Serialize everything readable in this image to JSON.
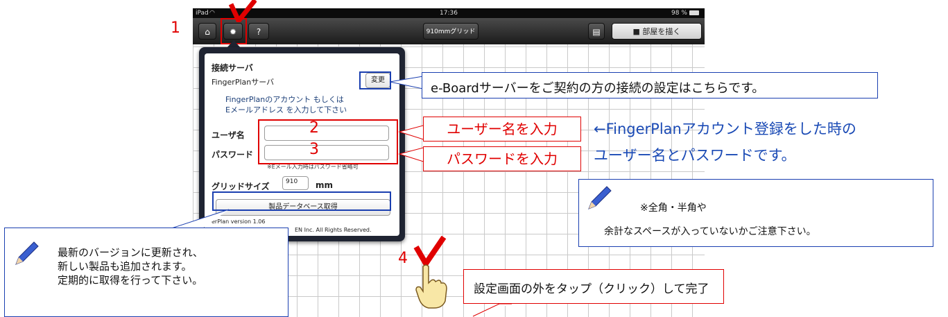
{
  "statusbar": {
    "device": "iPad",
    "time": "17:36",
    "battery": "98 %"
  },
  "toolbar": {
    "grid_button": "910mmグリッド",
    "draw_room_button": "■ 部屋を描く",
    "help_button": "?"
  },
  "settings": {
    "server_heading": "接続サーバ",
    "server_value": "FingerPlanサーバ",
    "change_button": "変更",
    "instruction_line1": "FingerPlanのアカウント もしくは",
    "instruction_line2": "Eメールアドレス を入力して下さい",
    "username_label": "ユーザ名",
    "password_label": "パスワード",
    "password_note": "※Eメール入力時はパスワード省略可",
    "grid_label": "グリッドサイズ",
    "grid_value": "910",
    "grid_unit": "mm",
    "product_db_button": "製品データベース取得",
    "version_line": "erPlan version  1.06",
    "copyright_line": "EN Inc. All Rights Reserved."
  },
  "annotations": {
    "step1": "1",
    "step2": "2",
    "step3": "3",
    "step4": "4",
    "server_callout": "e-Boardサーバーをご契約の方の接続の設定はこちらです。",
    "username_callout": "ユーザー名を入力",
    "password_callout": "パスワードを入力",
    "account_note_line1": "←FingerPlanアカウント登録をした時の",
    "account_note_line2": "ユーザー名とパスワードです。",
    "caution_line1": "※全角・半角や",
    "caution_line2": "余計なスペースが入っていないかご注意下さい。",
    "update_line1": "最新のバージョンに更新され、",
    "update_line2": "新しい製品も追加されます。",
    "update_line3": "定期的に取得を行って下さい。",
    "finish_callout": "設定画面の外をタップ（クリック）して完了"
  },
  "colors": {
    "annotation_red": "#e00000",
    "annotation_blue": "#1a3fb0",
    "text_blue": "#1a4ab5"
  }
}
